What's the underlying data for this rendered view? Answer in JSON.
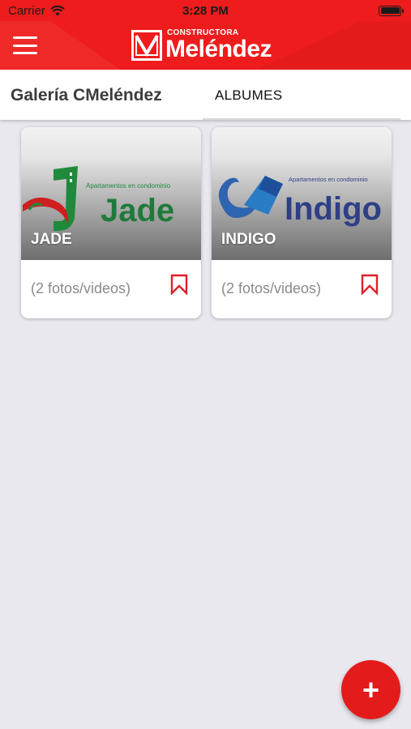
{
  "status_bar": {
    "carrier": "Carrier",
    "time": "3:28 PM"
  },
  "app_bar": {
    "logo_small": "CONSTRUCTORA",
    "logo_big": "Meléndez"
  },
  "header": {
    "title": "Galería CMeléndez",
    "tab_label": "ALBUMES"
  },
  "albums": [
    {
      "title": "JADE",
      "count": "(2 fotos/videos)",
      "logo_caption": "Apartamentos en condominio",
      "logo_word": "Jade"
    },
    {
      "title": "INDIGO",
      "count": "(2 fotos/videos)",
      "logo_caption": "Apartamentos en condominio",
      "logo_word": "Indigo"
    }
  ],
  "fab": {
    "label": "+"
  },
  "colors": {
    "primary": "#ee1c1c",
    "jade_green": "#1f7a3a",
    "indigo_blue": "#2e3f86",
    "background": "#e9e8ef"
  },
  "icons": {
    "menu": "hamburger-icon",
    "wifi": "wifi-icon",
    "battery": "battery-icon",
    "bookmark": "bookmark-icon"
  }
}
